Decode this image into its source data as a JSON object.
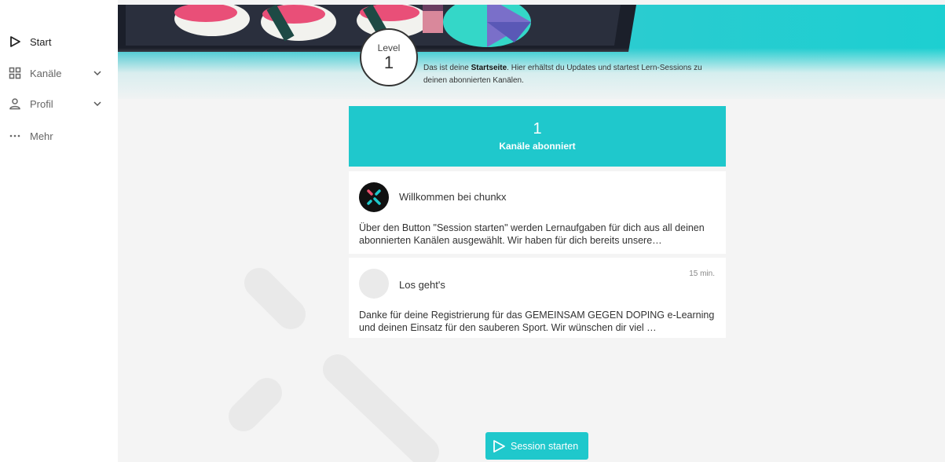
{
  "sidebar": {
    "items": [
      {
        "label": "Start",
        "icon": "play-outline-icon",
        "active": true
      },
      {
        "label": "Kanäle",
        "icon": "grid-icon",
        "expandable": true
      },
      {
        "label": "Profil",
        "icon": "person-icon",
        "expandable": true
      },
      {
        "label": "Mehr",
        "icon": "dots-icon"
      }
    ]
  },
  "level": {
    "label": "Level",
    "value": "1"
  },
  "intro": {
    "prefix": "Das ist deine ",
    "highlight": "Startseite",
    "suffix": ". Hier erhältst du Updates und startest Lern-Sessions zu deinen abonnierten Kanälen."
  },
  "channels": {
    "count": "1",
    "label": "Kanäle abonniert"
  },
  "feed": [
    {
      "title": "Willkommen bei chunkx",
      "time": "",
      "body": "Über den Button \"Session starten\" werden Lernaufgaben für dich aus all deinen abonnierten Kanälen ausgewählt. Wir haben für dich bereits unsere…"
    },
    {
      "title": "Los geht's",
      "time": "15 min.",
      "body": "Danke für deine Registrierung für das GEMEINSAM GEGEN DOPING e-Learning und deinen Einsatz für den sauberen Sport. Wir wünschen dir viel …"
    }
  ],
  "session_button": {
    "label": "Session starten"
  },
  "colors": {
    "accent": "#1fc8cc",
    "background": "#f4f4f4"
  }
}
